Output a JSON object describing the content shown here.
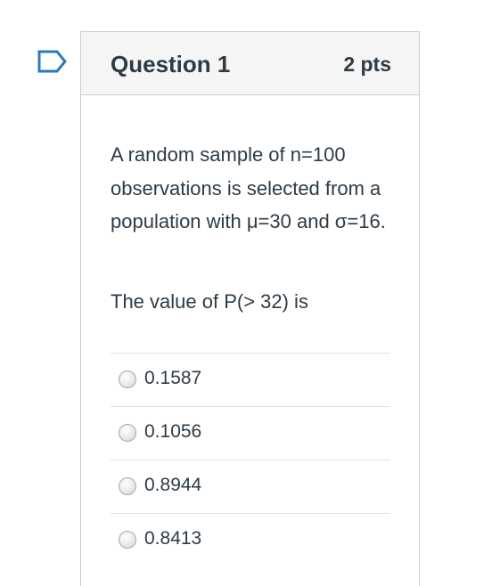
{
  "question": {
    "title": "Question 1",
    "points": "2 pts",
    "text": "A random sample of n=100 observations is selected from a population with μ=30 and σ=16.",
    "prompt": "The value of P(> 32) is"
  },
  "answers": [
    {
      "label": "0.1587",
      "selected": false
    },
    {
      "label": "0.1056",
      "selected": false
    },
    {
      "label": "0.8944",
      "selected": false
    },
    {
      "label": "0.8413",
      "selected": false
    }
  ],
  "colors": {
    "flag": "#2b7abc",
    "text": "#2d3b45",
    "header_bg": "#f5f5f5",
    "border": "#c7cdd1"
  },
  "icons": {
    "flag": "bookmark-flag-icon"
  }
}
